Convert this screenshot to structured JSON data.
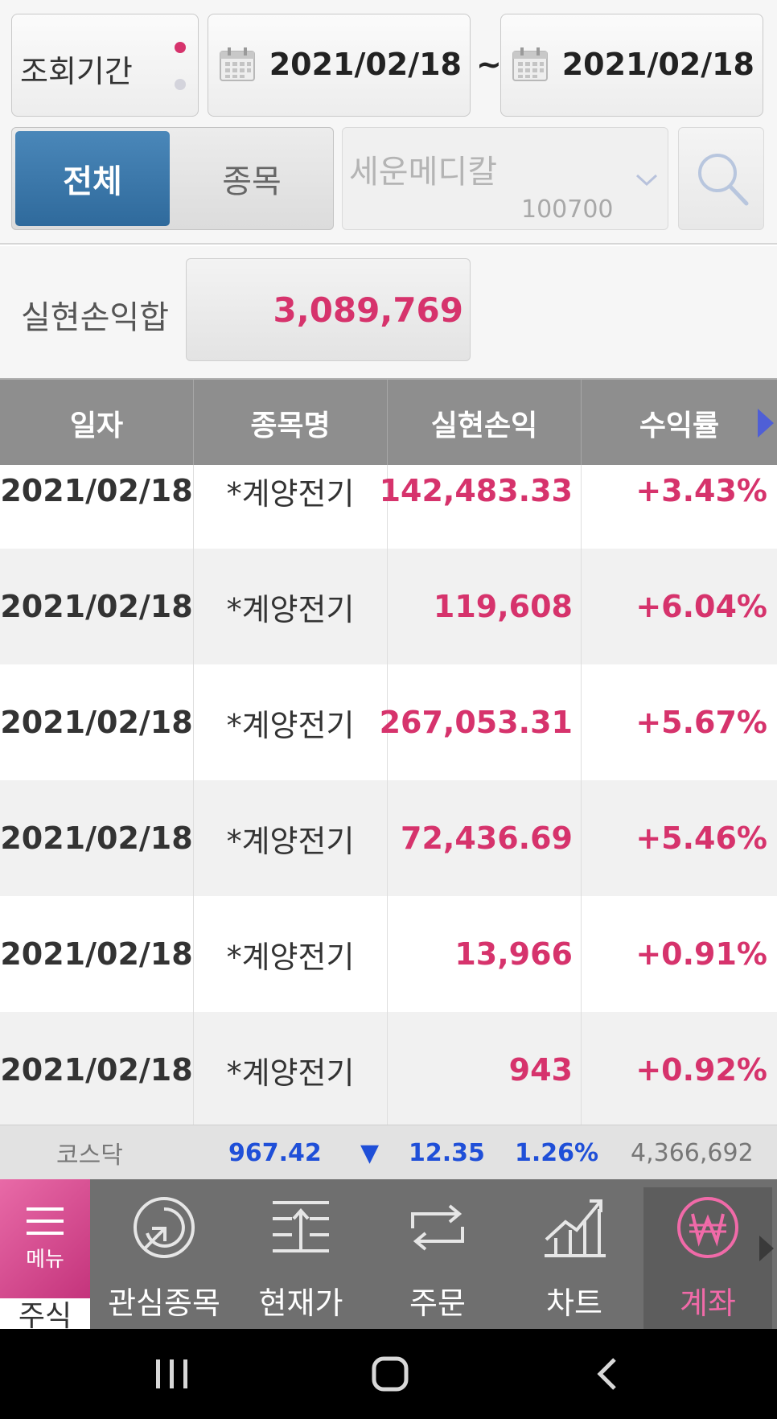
{
  "filter": {
    "period_label": "조회기간",
    "start_date": "2021/02/18",
    "separator": "~",
    "end_date": "2021/02/18",
    "segment": {
      "all_label": "전체",
      "stock_label": "종목",
      "active": "all"
    },
    "stock": {
      "name": "세운메디칼",
      "code": "100700"
    }
  },
  "summary": {
    "label": "실현손익합",
    "value": "3,089,769"
  },
  "table": {
    "columns": [
      "일자",
      "종목명",
      "실현손익",
      "수익률"
    ],
    "rows": [
      {
        "date": "2021/02/18",
        "name": "*계양전기",
        "pnl": "142,483.33",
        "rate": "+3.43%"
      },
      {
        "date": "2021/02/18",
        "name": "*계양전기",
        "pnl": "119,608",
        "rate": "+6.04%"
      },
      {
        "date": "2021/02/18",
        "name": "*계양전기",
        "pnl": "267,053.31",
        "rate": "+5.67%"
      },
      {
        "date": "2021/02/18",
        "name": "*계양전기",
        "pnl": "72,436.69",
        "rate": "+5.46%"
      },
      {
        "date": "2021/02/18",
        "name": "*계양전기",
        "pnl": "13,966",
        "rate": "+0.91%"
      },
      {
        "date": "2021/02/18",
        "name": "*계양전기",
        "pnl": "943",
        "rate": "+0.92%"
      }
    ]
  },
  "ticker": {
    "index_name": "코스닥",
    "value": "967.42",
    "direction_glyph": "▼",
    "change": "12.35",
    "change_pct": "1.26%",
    "volume": "4,366,692"
  },
  "nav": {
    "menu_label": "메뉴",
    "stock_tab": "주식",
    "items": [
      {
        "label": "관심종목",
        "icon": "refresh-arrow-icon"
      },
      {
        "label": "현재가",
        "icon": "price-list-icon"
      },
      {
        "label": "주문",
        "icon": "exchange-icon"
      },
      {
        "label": "차트",
        "icon": "chart-icon"
      },
      {
        "label": "계좌",
        "icon": "won-icon",
        "active": true
      }
    ]
  },
  "colors": {
    "accent_pink": "#d6336c",
    "segment_blue": "#3a77a8",
    "ticker_blue": "#1f4fd8"
  }
}
